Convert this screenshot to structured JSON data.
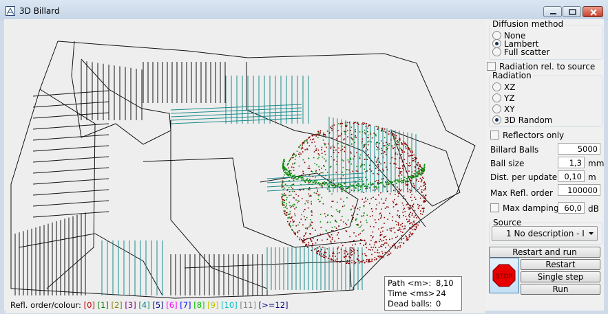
{
  "window": {
    "title": "3D Billard"
  },
  "diffusion": {
    "label": "Diffusion method",
    "options": [
      "None",
      "Lambert",
      "Full scatter"
    ],
    "selected": "Lambert"
  },
  "radiation_rel_source": {
    "label": "Radiation rel. to source",
    "checked": false
  },
  "radiation": {
    "label": "Radiation",
    "options": [
      "XZ",
      "YZ",
      "XY",
      "3D Random"
    ],
    "selected": "3D Random"
  },
  "reflectors_only": {
    "label": "Reflectors only",
    "checked": false
  },
  "params": {
    "billard_balls": {
      "label": "Billard Balls",
      "value": "5000",
      "unit": ""
    },
    "ball_size": {
      "label": "Ball size",
      "value": "1,3",
      "unit": "mm"
    },
    "dist_per_update": {
      "label": "Dist. per update",
      "value": "0,10",
      "unit": "m"
    },
    "max_refl_order": {
      "label": "Max Refl. order",
      "value": "100000",
      "unit": ""
    }
  },
  "max_damping": {
    "label": "Max damping",
    "value": "60,0",
    "unit": "dB",
    "checked": false
  },
  "source": {
    "label": "Source",
    "selected": "1 No description  -  I"
  },
  "buttons": {
    "restart_and_run": "Restart and run",
    "restart": "Restart",
    "single_step": "Single step",
    "run": "Run",
    "stop": "STOP"
  },
  "status": {
    "path_label": "Path <m>:",
    "path_value": "8,10",
    "time_label": "Time <ms>",
    "time_value": "24",
    "dead_label": "Dead balls:",
    "dead_value": "0"
  },
  "legend": {
    "prefix": "Refl. order/colour:",
    "items": [
      {
        "text": "[0]",
        "color": "#c00000"
      },
      {
        "text": "[1]",
        "color": "#008000"
      },
      {
        "text": "[2]",
        "color": "#808000"
      },
      {
        "text": "[3]",
        "color": "#800080"
      },
      {
        "text": "[4]",
        "color": "#008080"
      },
      {
        "text": "[5]",
        "color": "#000080"
      },
      {
        "text": "[6]",
        "color": "#ff00ff"
      },
      {
        "text": "[7]",
        "color": "#0000ff"
      },
      {
        "text": "[8]",
        "color": "#00c000"
      },
      {
        "text": "[9]",
        "color": "#c0c000"
      },
      {
        "text": "[10]",
        "color": "#00c0c0"
      },
      {
        "text": "[11]",
        "color": "#808080"
      },
      {
        "text": "[>=12]",
        "color": "#000080"
      }
    ]
  },
  "colors": {
    "wire": "#111111",
    "rays": "#1a8a8a",
    "ball_red": "#8b0000",
    "ball_green": "#0a8a0a"
  }
}
